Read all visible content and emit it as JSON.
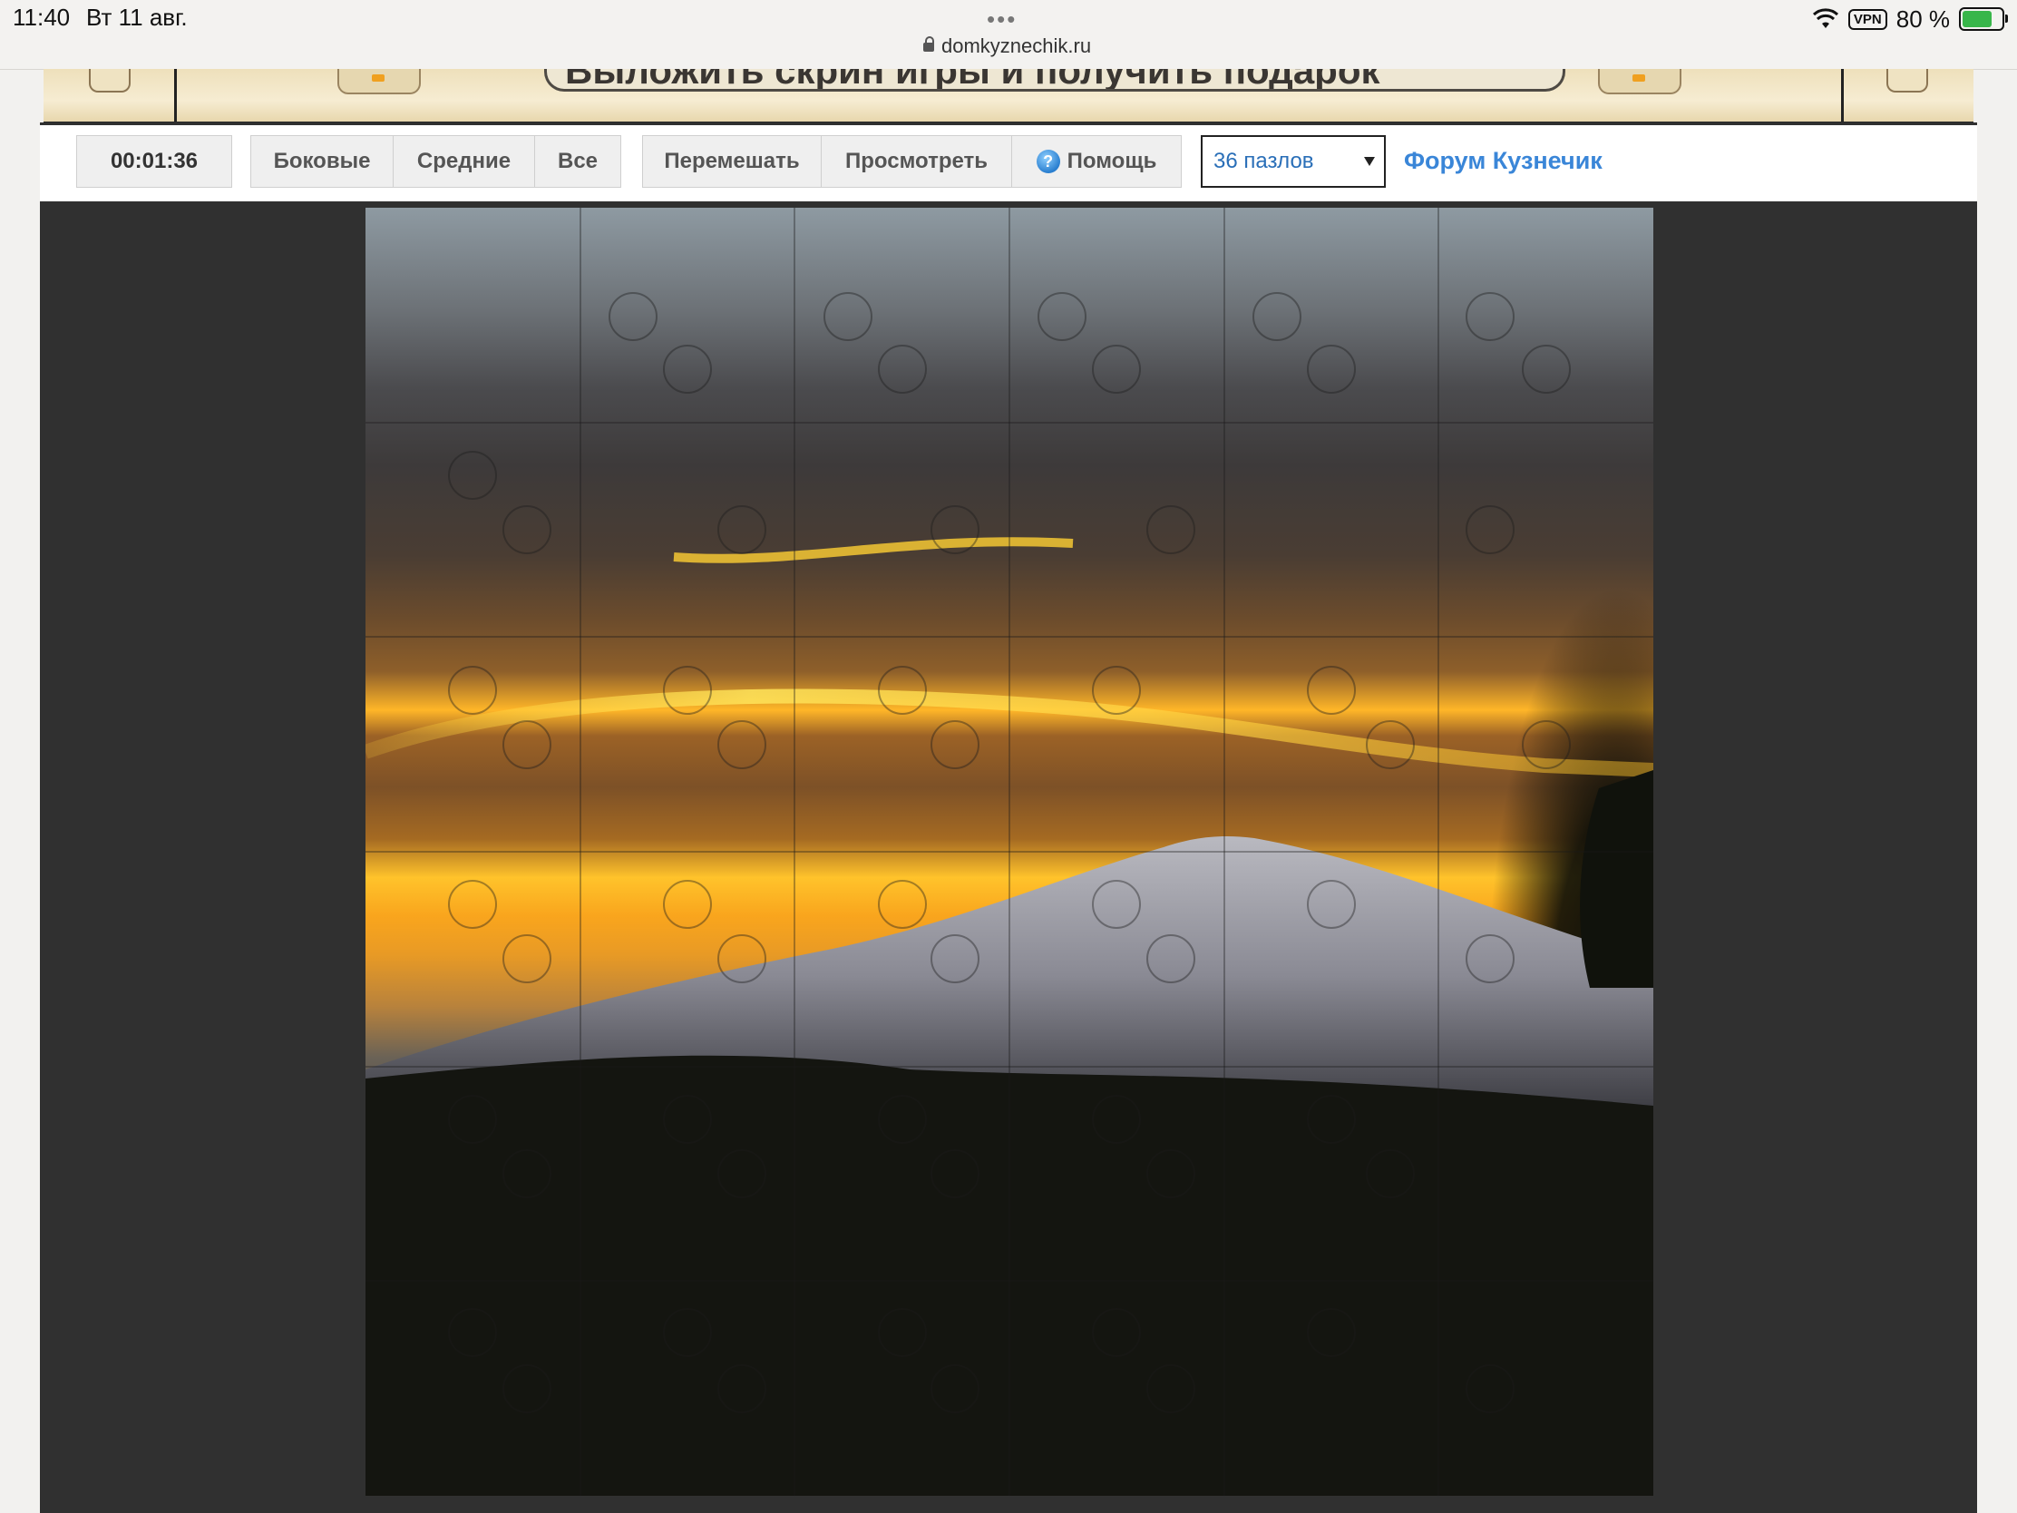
{
  "status_bar": {
    "time": "11:40",
    "date": "Вт 11 авг.",
    "url": "domkyznechik.ru",
    "vpn_label": "VPN",
    "battery": "80 %"
  },
  "banner": {
    "promo_text": "Выложить скрин игры и получить подарок"
  },
  "toolbar": {
    "timer": "00:01:36",
    "filter_side": "Боковые",
    "filter_middle": "Средние",
    "filter_all": "Все",
    "shuffle": "Перемешать",
    "preview": "Просмотреть",
    "help": "Помощь",
    "pieces_select": "36 пазлов",
    "forum_link": "Форум Кузнечик"
  },
  "puzzle": {
    "rows": 6,
    "cols": 6,
    "image_subject": "sunset over snowy volcano"
  },
  "colors": {
    "toolbar_bg": "#ffffff",
    "frame_bg": "#303030",
    "link": "#3a86d8",
    "select_text": "#2a6fb8"
  }
}
